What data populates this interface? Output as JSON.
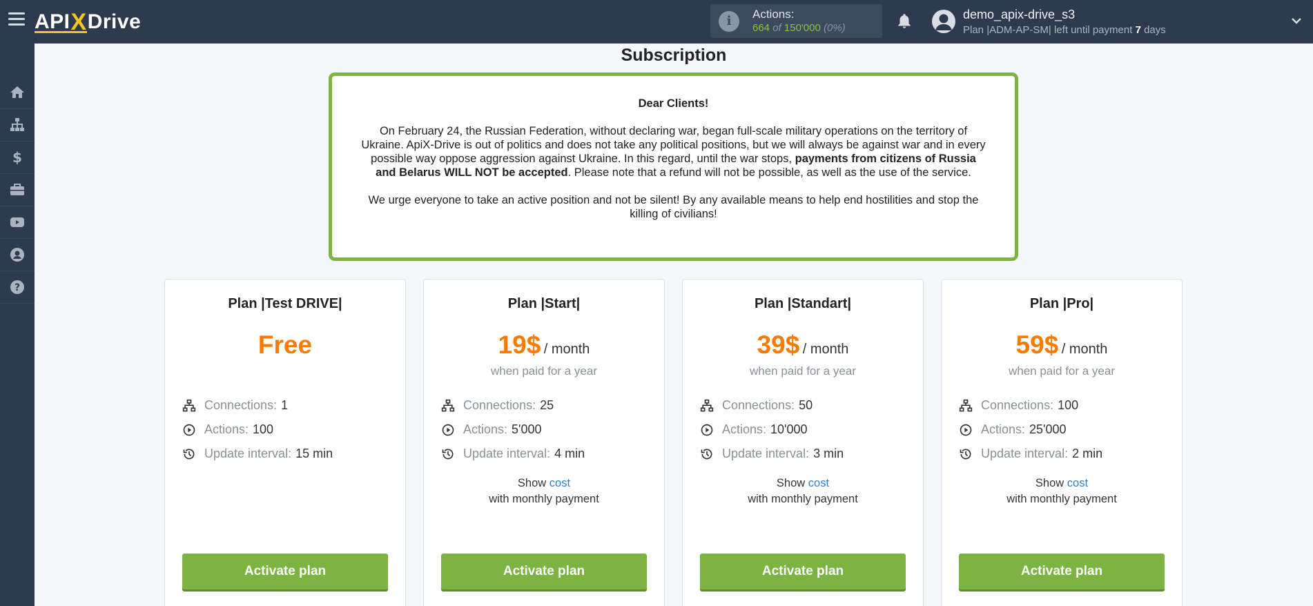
{
  "header": {
    "logo": {
      "part1": "API",
      "x": "X",
      "part2": "Drive"
    },
    "actions": {
      "title": "Actions:",
      "used": "664",
      "of": "of",
      "total": "150'000",
      "percent": "(0%)"
    },
    "user": {
      "name": "demo_apix-drive_s3",
      "plan_prefix": "Plan |ADM-AP-SM| left until payment",
      "days_number": "7",
      "days_suffix": "days"
    }
  },
  "sidebar": {
    "items": [
      {
        "icon": "home-icon"
      },
      {
        "icon": "sitemap-icon"
      },
      {
        "icon": "dollar-icon"
      },
      {
        "icon": "briefcase-icon"
      },
      {
        "icon": "youtube-icon"
      },
      {
        "icon": "user-circle-icon"
      },
      {
        "icon": "question-circle-icon"
      }
    ]
  },
  "page": {
    "title": "Subscription",
    "notice": {
      "heading": "Dear Clients!",
      "p1_start": "On February 24, the Russian Federation, without declaring war, began full-scale military operations on the territory of Ukraine. ApiX-Drive is out of politics and does not take any political positions, but we will always be against war and in every possible way oppose aggression against Ukraine. In this regard, until the war stops, ",
      "p1_bold": "payments from citizens of Russia and Belarus WILL NOT be accepted",
      "p1_end": ". Please note that a refund will not be possible, as well as the use of the service.",
      "p2": "We urge everyone to take an active position and not be silent! By any available means to help end hostilities and stop the killing of civilians!"
    },
    "labels": {
      "connections": "Connections:",
      "actions": "Actions:",
      "update_interval": "Update interval:",
      "show": "Show",
      "cost": "cost",
      "with_monthly": "with monthly payment",
      "per_month": "/ month",
      "when_paid_year": "when paid for a year",
      "activate": "Activate plan"
    },
    "plans": [
      {
        "name": "Plan |Test DRIVE|",
        "price": "Free",
        "connections": "1",
        "actions": "100",
        "interval": "15 min"
      },
      {
        "name": "Plan |Start|",
        "price": "19$",
        "connections": "25",
        "actions": "5'000",
        "interval": "4 min"
      },
      {
        "name": "Plan |Standart|",
        "price": "39$",
        "connections": "50",
        "actions": "10'000",
        "interval": "3 min"
      },
      {
        "name": "Plan |Pro|",
        "price": "59$",
        "connections": "100",
        "actions": "25'000",
        "interval": "2 min"
      }
    ]
  },
  "colors": {
    "topbar": "#2e3b4e",
    "accent_green": "#7cb342",
    "price_orange": "#f57c00",
    "link_blue": "#2f80c2"
  }
}
